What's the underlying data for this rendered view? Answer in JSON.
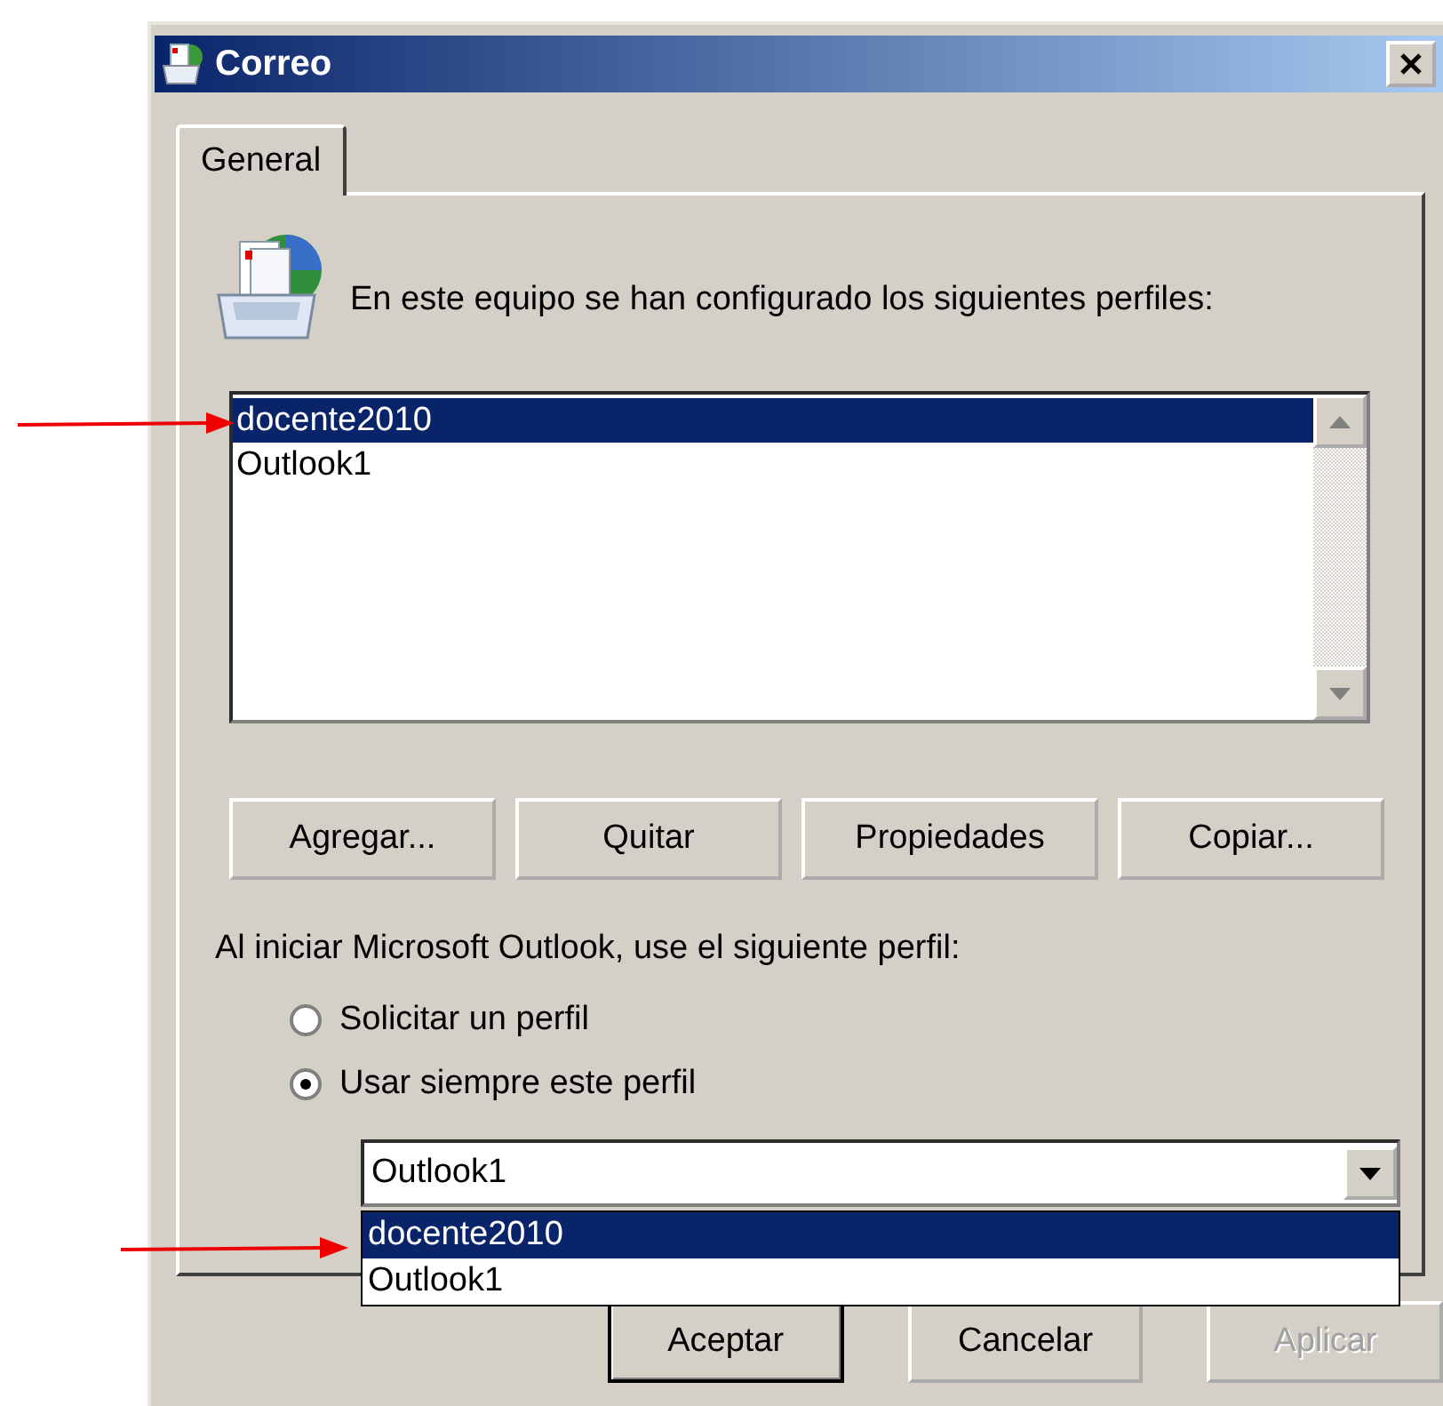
{
  "window": {
    "title": "Correo"
  },
  "tabs": [
    {
      "label": "General",
      "selected": true
    }
  ],
  "intro": "En este equipo se han configurado los siguientes perfiles:",
  "profiles": [
    {
      "name": "docente2010",
      "selected": true
    },
    {
      "name": "Outlook1",
      "selected": false
    }
  ],
  "profile_buttons": [
    {
      "label": "Agregar..."
    },
    {
      "label": "Quitar"
    },
    {
      "label": "Propiedades"
    },
    {
      "label": "Copiar..."
    }
  ],
  "startup": {
    "label": "Al iniciar Microsoft Outlook, use el siguiente perfil:",
    "options": [
      {
        "label": "Solicitar un perfil",
        "selected": false
      },
      {
        "label": "Usar siempre este perfil",
        "selected": true
      }
    ]
  },
  "profile_combo": {
    "value": "Outlook1",
    "expanded": true,
    "options": [
      {
        "label": "docente2010",
        "highlighted": true
      },
      {
        "label": "Outlook1",
        "highlighted": false
      }
    ]
  },
  "dialog_buttons": [
    {
      "label": "Aceptar",
      "default": true,
      "disabled": false
    },
    {
      "label": "Cancelar",
      "default": false,
      "disabled": false
    },
    {
      "label": "Aplicar",
      "default": false,
      "disabled": true
    }
  ]
}
